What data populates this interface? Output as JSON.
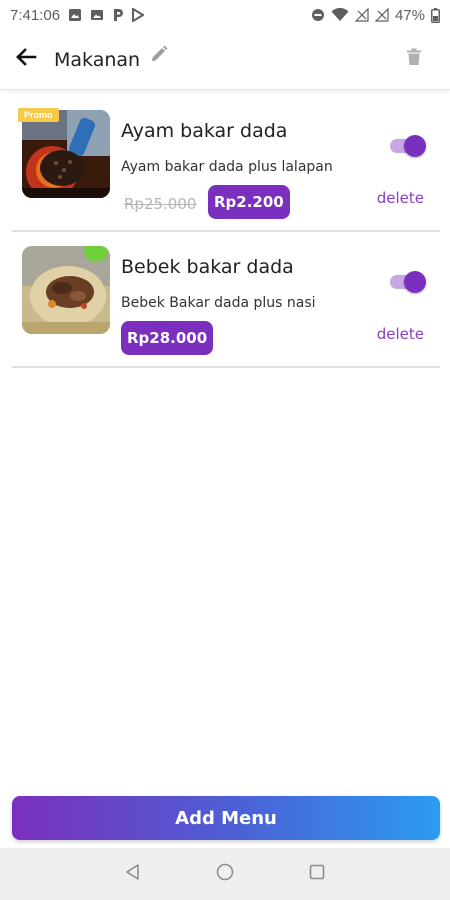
{
  "status_bar": {
    "time": "7:41:06",
    "battery": "47%",
    "icons": [
      "gallery-icon",
      "image-icon",
      "parking-icon",
      "play-store-icon",
      "do-not-disturb-icon",
      "wifi-icon",
      "no-signal-icon",
      "no-signal-icon",
      "battery-icon"
    ]
  },
  "app_bar": {
    "title": "Makanan",
    "back_icon": "arrow-left-icon",
    "edit_icon": "pencil-icon",
    "delete_icon": "trash-icon"
  },
  "menu_items": [
    {
      "name": "Ayam bakar dada",
      "description": "Ayam bakar dada plus lalapan",
      "promo_label": "Promo",
      "old_price": "Rp25.000",
      "price": "Rp2.200",
      "available": true,
      "delete_label": "delete"
    },
    {
      "name": "Bebek bakar dada",
      "description": "Bebek Bakar dada plus nasi",
      "price": "Rp28.000",
      "available": true,
      "delete_label": "delete"
    }
  ],
  "add_button": {
    "label": "Add Menu"
  },
  "nav_bar": {
    "icons": [
      "back-triangle-icon",
      "home-circle-icon",
      "recents-square-icon"
    ]
  },
  "colors": {
    "accent": "#7b2fbe",
    "toggle_track": "#c7a6e4",
    "delete_text": "#8a3fc8",
    "promo": "#f6c94a",
    "gradient_start": "#7b2fbe",
    "gradient_end": "#2b9cf2"
  }
}
